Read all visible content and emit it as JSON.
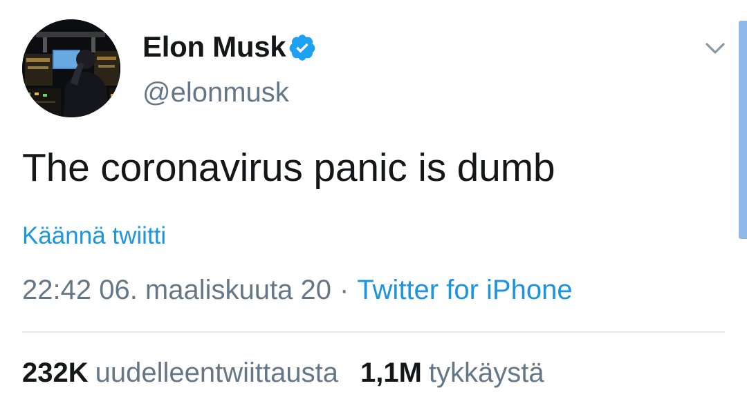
{
  "tweet": {
    "author": {
      "display_name": "Elon Musk",
      "handle": "@elonmusk",
      "verified": true,
      "verified_icon": "verified-badge-icon"
    },
    "menu_icon": "chevron-down-icon",
    "text": "The coronavirus panic is dumb",
    "translate_label": "Käännä twiitti",
    "timestamp": "22:42 06. maaliskuuta 20",
    "separator": "·",
    "source": "Twitter for iPhone",
    "stats": {
      "retweets_count": "232K",
      "retweets_label": "uudelleentwiittausta",
      "likes_count": "1,1M",
      "likes_label": "tykkäystä"
    }
  },
  "colors": {
    "text_primary": "#14171a",
    "text_secondary": "#657786",
    "link": "#1b95e0",
    "verified_badge": "#1da1f2",
    "divider": "#e1e8ed",
    "scrollbar": "#90b8e8"
  }
}
